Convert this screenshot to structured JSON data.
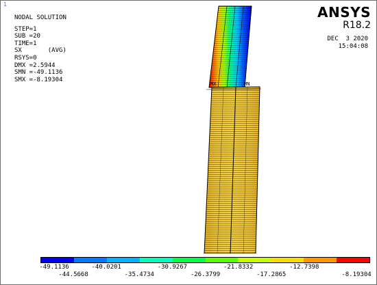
{
  "window_number": "1",
  "info": {
    "title": "NODAL SOLUTION",
    "step": "STEP=1",
    "sub": "SUB =20",
    "time": "TIME=1",
    "component": "SX       (AVG)",
    "rsys": "RSYS=0",
    "dmx": "DMX =2.5944",
    "smn": "SMN =-49.1136",
    "smx": "SMX =-8.19304"
  },
  "brand": {
    "name": "ANSYS",
    "version": "R18.2"
  },
  "timestamp": {
    "date": "DEC  3 2020",
    "time": "15:04:08"
  },
  "node_labels": {
    "min_marker": "MN",
    "max_marker": "MX"
  },
  "legend": {
    "colors": [
      "#0000ff",
      "#0078ff",
      "#00b4ff",
      "#00ffbe",
      "#00ff46",
      "#5aff00",
      "#c8ff00",
      "#ffdc00",
      "#ff9600",
      "#ff0000"
    ],
    "top_labels": [
      "-49.1136",
      "-40.0201",
      "-30.9267",
      "-21.8332",
      "-12.7398"
    ],
    "bottom_labels": [
      "-44.5668",
      "-35.4734",
      "-26.3799",
      "-17.2865",
      "-8.19304"
    ]
  }
}
